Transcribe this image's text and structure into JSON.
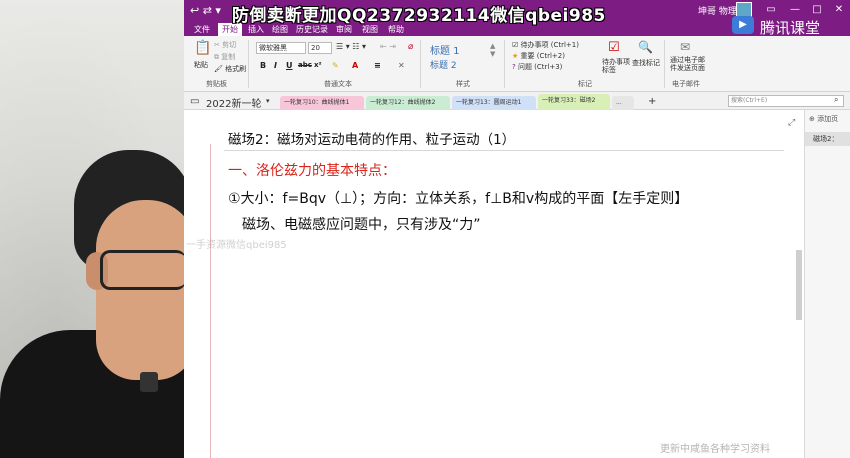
{
  "watermarks": {
    "top": "防倒卖断更加QQ2372932114微信qbei985",
    "brand": "腾讯课堂",
    "mid": "一手资源微信qbei985",
    "bottom": "更新中咸鱼各种学习资料"
  },
  "titlebar": {
    "user": "坤哥 物理"
  },
  "menu": {
    "tabs": [
      "文件",
      "开始",
      "插入",
      "绘图",
      "历史记录",
      "审阅",
      "视图",
      "帮助"
    ],
    "active": "开始"
  },
  "ribbon": {
    "clipboard": {
      "paste": "粘贴",
      "cut": "剪切",
      "copy": "复制",
      "format_painter": "格式刷",
      "label": "剪贴板"
    },
    "font": {
      "family": "微软雅黑",
      "size": "20",
      "label": "普通文本"
    },
    "styles": {
      "h1": "标题 1",
      "h2": "标题 2",
      "label": "样式"
    },
    "tags": {
      "todo": "待办事项 (Ctrl+1)",
      "important": "重要 (Ctrl+2)",
      "question": "问题 (Ctrl+3)",
      "todo_tag": "待办事项标签",
      "find_tags": "查找标记",
      "label": "标记"
    },
    "email": {
      "send": "通过电子邮件发送页面",
      "label": "电子邮件"
    }
  },
  "notebook": {
    "name": "2022新一轮",
    "sections": [
      {
        "label": "一轮复习10：曲线抛体1",
        "color": "#f7c6d9"
      },
      {
        "label": "一轮复习12：曲线抛体2",
        "color": "#c9ecd2"
      },
      {
        "label": "一轮复习13：圆周运动1",
        "color": "#cfe0f7"
      },
      {
        "label": "一轮复习33：磁场2",
        "color": "#d8f0b8"
      }
    ],
    "more": "...",
    "add": "+",
    "search_placeholder": "搜索(Ctrl+E)"
  },
  "page": {
    "title": "磁场2：磁场对运动电荷的作用、粒子运动（1）",
    "lines": [
      "一、洛伦兹力的基本特点：",
      "①大小：f=Bqv（⊥）；方向：立体关系，f⊥B和v构成的平面【左手定则】",
      "磁场、电磁感应问题中，只有涉及“力”"
    ]
  },
  "page_list": {
    "add_page": "⊕ 添加页",
    "entry": "磁场2："
  },
  "colors": {
    "onenote_purple": "#7d1d84",
    "heading_red": "#d9231a"
  }
}
